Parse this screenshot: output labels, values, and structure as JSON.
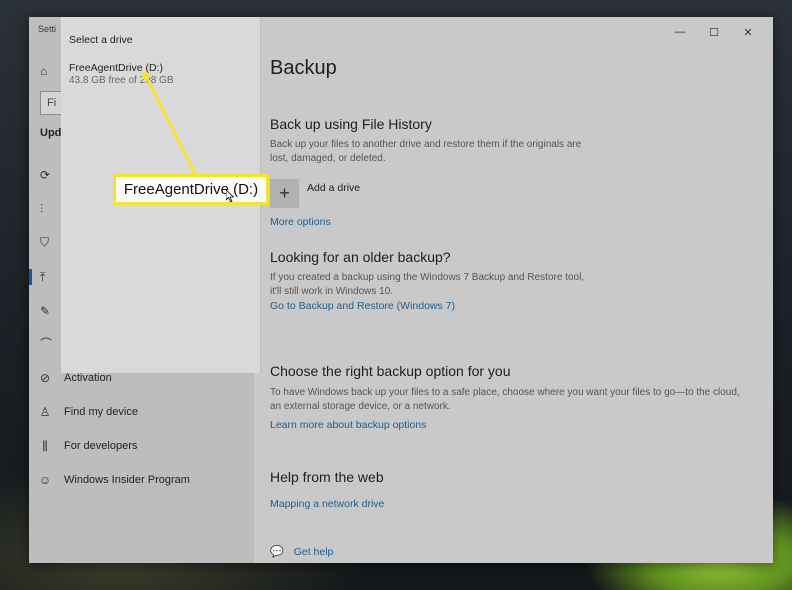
{
  "window": {
    "title": "Setti",
    "controls": {
      "minimize": "—",
      "maximize": "☐",
      "close": "✕"
    }
  },
  "sidebar": {
    "search_placeholder": "Fi",
    "section_label": "Upd",
    "items": [
      {
        "label": "Activation",
        "icon": "check-circle-icon"
      },
      {
        "label": "Find my device",
        "icon": "person-locate-icon"
      },
      {
        "label": "For developers",
        "icon": "developer-tools-icon"
      },
      {
        "label": "Windows Insider Program",
        "icon": "insider-icon"
      }
    ]
  },
  "drive_picker": {
    "title": "Select a drive",
    "drives": [
      {
        "name": "FreeAgentDrive (D:)",
        "space": "43.8 GB free of 298 GB"
      }
    ]
  },
  "callout": {
    "text": "FreeAgentDrive (D:)",
    "color": "#f4e42f"
  },
  "main": {
    "title": "Backup",
    "file_history": {
      "heading": "Back up using File History",
      "description": "Back up your files to another drive and restore them if the originals are lost, damaged, or deleted.",
      "add_drive": "Add a drive",
      "more_options": "More options"
    },
    "older_backup": {
      "heading": "Looking for an older backup?",
      "description": "If you created a backup using the Windows 7 Backup and Restore tool, it'll still work in Windows 10.",
      "link": "Go to Backup and Restore (Windows 7)"
    },
    "right_option": {
      "heading": "Choose the right backup option for you",
      "description": "To have Windows back up your files to a safe place, choose where you want your files to go—to the cloud, an external storage device, or a network.",
      "link": "Learn more about backup options"
    },
    "web_help": {
      "heading": "Help from the web",
      "link": "Mapping a network drive"
    },
    "get_help": "Get help"
  },
  "colors": {
    "accent": "#0b5cad",
    "link": "#1f5e8e",
    "highlight": "#f4e42f"
  }
}
